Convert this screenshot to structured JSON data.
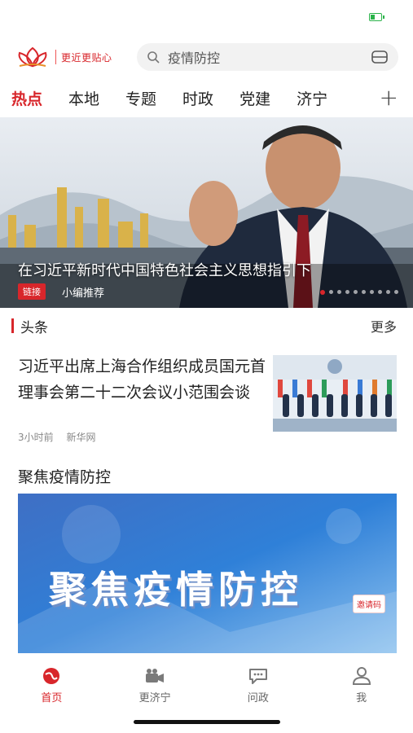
{
  "header": {
    "slogan": "更近更贴心",
    "search_placeholder": "疫情防控"
  },
  "tabs": [
    "热点",
    "本地",
    "专题",
    "时政",
    "党建",
    "济宁"
  ],
  "banner": {
    "title": "在习近平新时代中国特色社会主义思想指引下",
    "tag": "链接",
    "subtitle": "小编推荐"
  },
  "headline_section": {
    "title": "头条",
    "more": "更多"
  },
  "news": {
    "title": "习近平出席上海合作组织成员国元首理事会第二十二次会议小范围会谈",
    "time": "3小时前",
    "source": "新华网"
  },
  "focus": {
    "title": "聚焦疫情防控",
    "image_text": "聚焦疫情防控",
    "badge": "邀请码"
  },
  "nav": [
    {
      "label": "首页",
      "icon": "home-globe-icon"
    },
    {
      "label": "更济宁",
      "icon": "video-camera-icon"
    },
    {
      "label": "问政",
      "icon": "chat-icon"
    },
    {
      "label": "我",
      "icon": "user-icon"
    }
  ],
  "colors": {
    "accent": "#d8262b"
  }
}
